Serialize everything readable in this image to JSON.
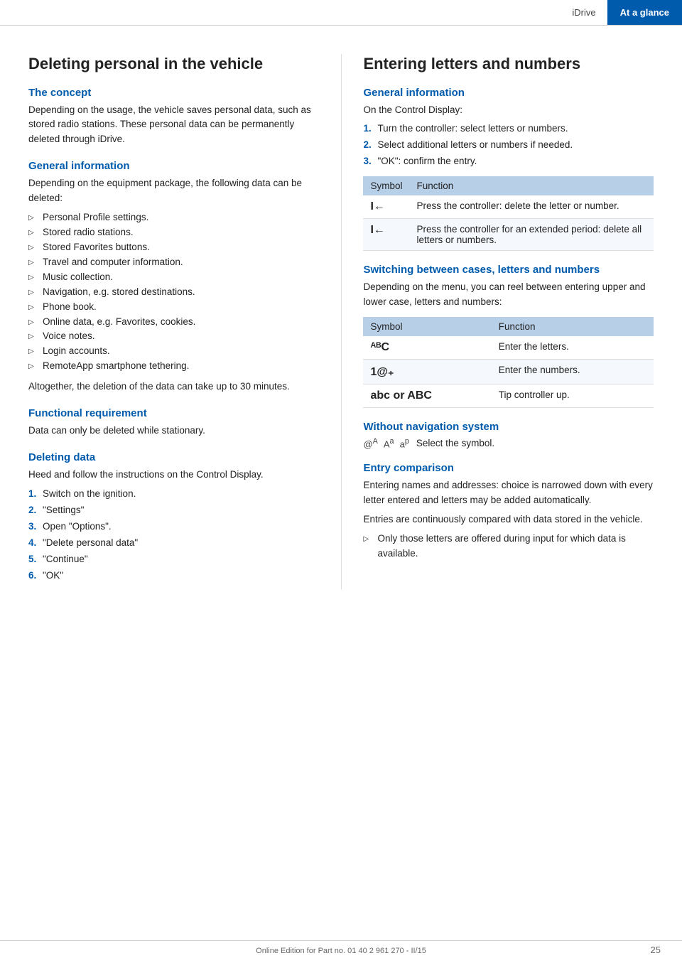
{
  "header": {
    "idrive_label": "iDrive",
    "tab_label": "At a glance"
  },
  "left": {
    "main_title": "Deleting personal in the vehicle",
    "concept": {
      "heading": "The concept",
      "text": "Depending on the usage, the vehicle saves personal data, such as stored radio stations. These personal data can be permanently deleted through iDrive."
    },
    "general_info": {
      "heading": "General information",
      "intro": "Depending on the equipment package, the following data can be deleted:",
      "items": [
        "Personal Profile settings.",
        "Stored radio stations.",
        "Stored Favorites buttons.",
        "Travel and computer information.",
        "Music collection.",
        "Navigation, e.g. stored destinations.",
        "Phone book.",
        "Online data, e.g. Favorites, cookies.",
        "Voice notes.",
        "Login accounts.",
        "RemoteApp smartphone tethering."
      ],
      "footer_text": "Altogether, the deletion of the data can take up to 30 minutes."
    },
    "functional_req": {
      "heading": "Functional requirement",
      "text": "Data can only be deleted while stationary."
    },
    "deleting_data": {
      "heading": "Deleting data",
      "intro": "Heed and follow the instructions on the Control Display.",
      "steps": [
        "Switch on the ignition.",
        "\"Settings\"",
        "Open \"Options\".",
        "\"Delete personal data\"",
        "\"Continue\"",
        "\"OK\""
      ]
    }
  },
  "right": {
    "main_title": "Entering letters and numbers",
    "general_info": {
      "heading": "General information",
      "intro": "On the Control Display:",
      "steps": [
        "Turn the controller: select letters or numbers.",
        "Select additional letters or numbers if needed.",
        "\"OK\": confirm the entry."
      ],
      "table": {
        "col1": "Symbol",
        "col2": "Function",
        "rows": [
          {
            "symbol": "I←",
            "function": "Press the controller: delete the letter or number."
          },
          {
            "symbol": "I←",
            "function": "Press the controller for an extended period: delete all letters or numbers."
          }
        ]
      }
    },
    "switching": {
      "heading": "Switching between cases, letters and numbers",
      "intro": "Depending on the menu, you can reel between entering upper and lower case, letters and numbers:",
      "table": {
        "col1": "Symbol",
        "col2": "Function",
        "rows": [
          {
            "symbol": "ᴬᴮC",
            "function": "Enter the letters."
          },
          {
            "symbol": "1@₊",
            "function": "Enter the numbers."
          },
          {
            "symbol": "abc or ABC",
            "function": "Tip controller up."
          }
        ]
      }
    },
    "without_nav": {
      "heading": "Without navigation system",
      "symbol_text": "Select the symbol.",
      "symbols": [
        "@ᴬ",
        "Aᵃ",
        "aᵖ"
      ]
    },
    "entry_comparison": {
      "heading": "Entry comparison",
      "text1": "Entering names and addresses: choice is narrowed down with every letter entered and letters may be added automatically.",
      "text2": "Entries are continuously compared with data stored in the vehicle.",
      "bullet": "Only those letters are offered during input for which data is available."
    }
  },
  "footer": {
    "text": "Online Edition for Part no. 01 40 2 961 270 - II/15",
    "page": "25"
  }
}
